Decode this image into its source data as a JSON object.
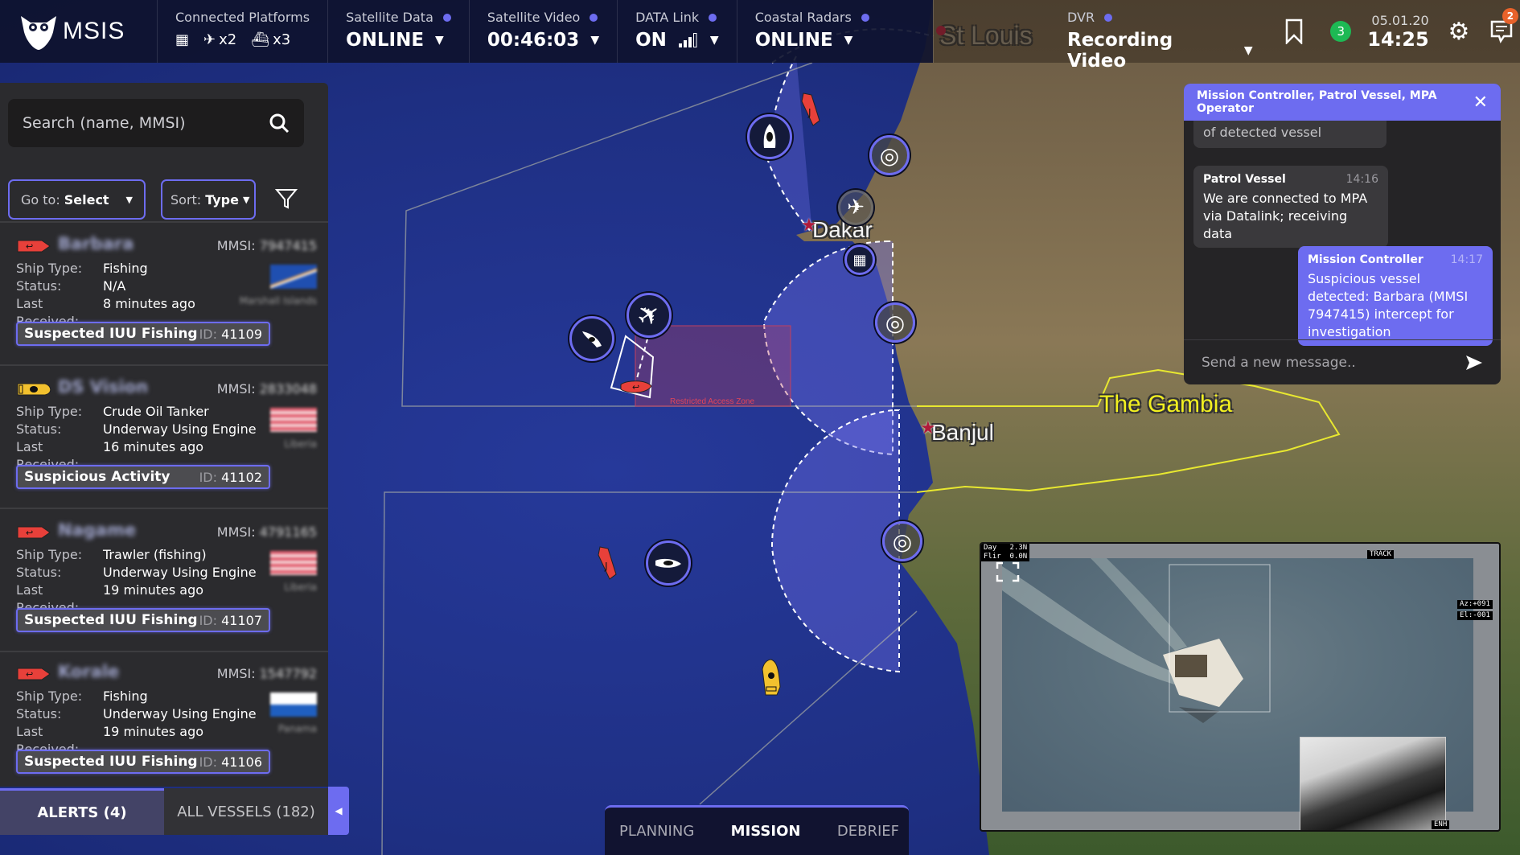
{
  "app": {
    "name": "MSIS"
  },
  "topbar": {
    "connected_platforms": {
      "label": "Connected Platforms",
      "aircraft_count": "x2",
      "vessel_count": "x3"
    },
    "satellite_data": {
      "label": "Satellite Data",
      "value": "ONLINE"
    },
    "satellite_video": {
      "label": "Satellite Video",
      "value": "00:46:03"
    },
    "data_link": {
      "label": "DATA Link",
      "value": "ON"
    },
    "coastal_radars": {
      "label": "Coastal Radars",
      "value": "ONLINE"
    },
    "dvr": {
      "label": "DVR",
      "value": "Recording Video"
    },
    "notifications_count": "3",
    "date": "05.01.20",
    "time": "14:25",
    "messages_count": "2",
    "status_dot_color": "#6d6cf0"
  },
  "left_panel": {
    "search_placeholder": "Search (name, MMSI)",
    "goto": {
      "label": "Go to:",
      "value": "Select"
    },
    "sort": {
      "label": "Sort:",
      "value": "Type"
    },
    "field_labels": {
      "ship_type": "Ship Type:",
      "status": "Status:",
      "last_received": "Last Received:",
      "mmsi": "MMSI:",
      "id": "ID:"
    },
    "vessels": [
      {
        "name": "Barbara",
        "mmsi": "7947415",
        "ship_type": "Fishing",
        "status": "N/A",
        "last_received": "8 minutes ago",
        "country": "Marshall Islands",
        "alert": "Suspected IUU Fishing",
        "alert_id": "41109",
        "icon_color": "#e8403a"
      },
      {
        "name": "DS Vision",
        "mmsi": "2833048",
        "ship_type": "Crude Oil Tanker",
        "status": "Underway Using Engine",
        "last_received": "16 minutes ago",
        "country": "Liberia",
        "alert": "Suspicious Activity",
        "alert_id": "41102",
        "icon_color": "#f2c12e"
      },
      {
        "name": "Nagame",
        "mmsi": "4791165",
        "ship_type": "Trawler (fishing)",
        "status": "Underway Using Engine",
        "last_received": "19 minutes ago",
        "country": "Liberia",
        "alert": "Suspected IUU Fishing",
        "alert_id": "41107",
        "icon_color": "#e8403a"
      },
      {
        "name": "Korale",
        "mmsi": "1547792",
        "ship_type": "Fishing",
        "status": "Underway Using Engine",
        "last_received": "19 minutes ago",
        "country": "Panama",
        "alert": "Suspected IUU Fishing",
        "alert_id": "41106",
        "icon_color": "#e8403a"
      }
    ],
    "tabs": [
      {
        "label": "ALERTS (4)",
        "active": true
      },
      {
        "label": "ALL VESSELS (182)",
        "active": false
      }
    ]
  },
  "map": {
    "labels": {
      "st_louis": "St Louis",
      "dakar": "Dakar",
      "banjul": "Banjul",
      "gambia": "The Gambia"
    },
    "restricted_zone_label": "Restricted Access Zone"
  },
  "mode_tabs": [
    {
      "label": "PLANNING",
      "active": false
    },
    {
      "label": "MISSION",
      "active": true
    },
    {
      "label": "DEBRIEF",
      "active": false
    }
  ],
  "chat": {
    "title": "Mission Controller, Patrol Vessel, MPA Operator",
    "messages": [
      {
        "text": "of detected vessel",
        "direction": "in"
      },
      {
        "sender": "Patrol Vessel",
        "time": "14:16",
        "text": "We are connected to MPA via Datalink; receiving data",
        "direction": "in"
      },
      {
        "sender": "Mission Controller",
        "time": "14:17",
        "text": "Suspicious vessel detected: Barbara (MMSI 7947415) intercept for investigation",
        "direction": "out"
      }
    ],
    "input_placeholder": "Send a new message.."
  },
  "video": {
    "osd_top_left": "Day   2.3N\nFlir  0.0N",
    "osd_mode": "TRACK",
    "osd_az": "Az:+091",
    "osd_el": "El:-001",
    "osd_thermal": "ENH"
  }
}
